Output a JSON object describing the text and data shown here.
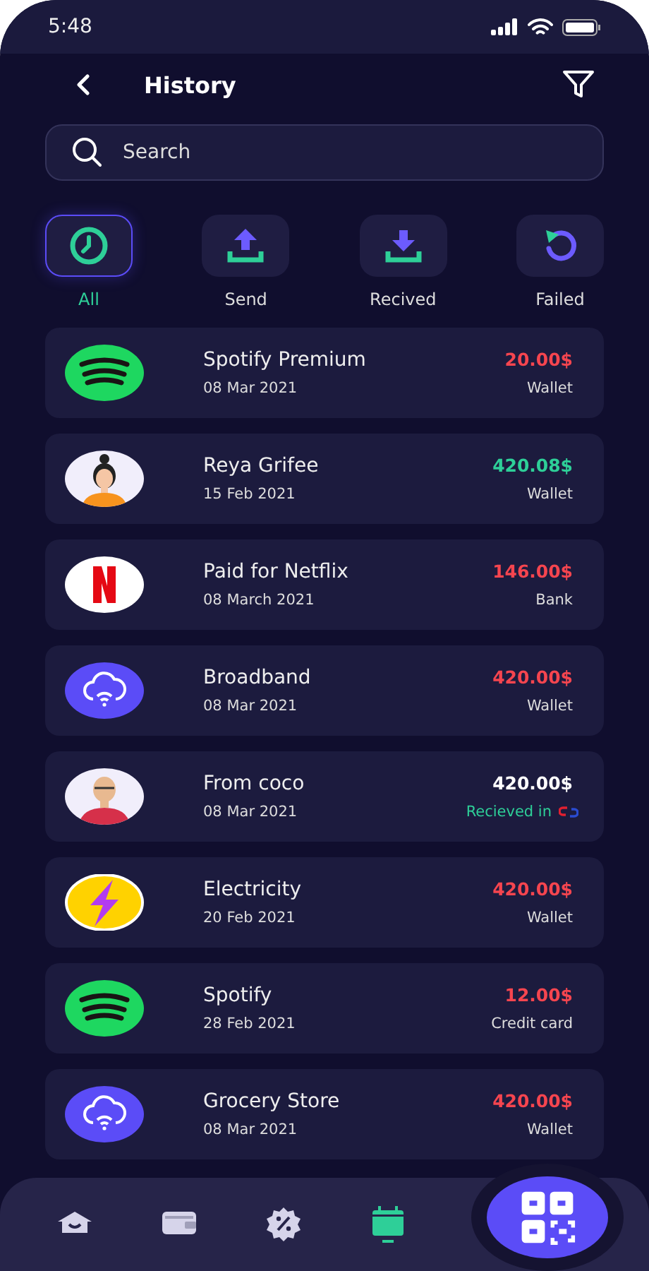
{
  "status_bar": {
    "time": "5:48"
  },
  "header": {
    "title": "History"
  },
  "search": {
    "placeholder": "Search"
  },
  "filters": [
    {
      "label": "All",
      "kind": "all",
      "selected": true
    },
    {
      "label": "Send",
      "kind": "send",
      "selected": false
    },
    {
      "label": "Recived",
      "kind": "received",
      "selected": false
    },
    {
      "label": "Failed",
      "kind": "failed",
      "selected": false
    }
  ],
  "transactions": [
    {
      "kind": "spotify",
      "name": "Spotify Premium",
      "date": "08 Mar 2021",
      "amount": "20.00$",
      "color": "#f5454f",
      "method": {
        "label": "Wallet",
        "kind": "plain"
      }
    },
    {
      "kind": "woman",
      "name": "Reya Grifee",
      "date": "15 Feb 2021",
      "amount": "420.08$",
      "color": "#2ecf98",
      "method": {
        "label": "Wallet",
        "kind": "plain"
      }
    },
    {
      "kind": "netflix",
      "name": "Paid for Netflix",
      "date": "08 March 2021",
      "amount": "146.00$",
      "color": "#f5454f",
      "method": {
        "label": "Bank",
        "kind": "plain"
      }
    },
    {
      "kind": "cloud",
      "name": "Broadband",
      "date": "08 Mar 2021",
      "amount": "420.00$",
      "color": "#f5454f",
      "method": {
        "label": "Wallet",
        "kind": "plain"
      }
    },
    {
      "kind": "man",
      "name": "From coco",
      "date": "08 Mar 2021",
      "amount": "420.00$",
      "color": "#ffffff",
      "method": {
        "label": "Recieved in",
        "kind": "bank_logo"
      }
    },
    {
      "kind": "bolt",
      "name": "Electricity",
      "date": "20 Feb 2021",
      "amount": "420.00$",
      "color": "#f5454f",
      "method": {
        "label": "Wallet",
        "kind": "plain"
      }
    },
    {
      "kind": "spotify",
      "name": "Spotify",
      "date": "28 Feb 2021",
      "amount": "12.00$",
      "color": "#f5454f",
      "method": {
        "label": "Credit card",
        "kind": "plain"
      }
    },
    {
      "kind": "cloud",
      "name": "Grocery Store",
      "date": "08 Mar 2021",
      "amount": "420.00$",
      "color": "#f5454f",
      "method": {
        "label": "Wallet",
        "kind": "plain"
      }
    }
  ],
  "bottom_nav": [
    {
      "kind": "home",
      "selected": false
    },
    {
      "kind": "wallet",
      "selected": false
    },
    {
      "kind": "discount",
      "selected": false
    },
    {
      "kind": "calendar",
      "selected": true
    }
  ]
}
